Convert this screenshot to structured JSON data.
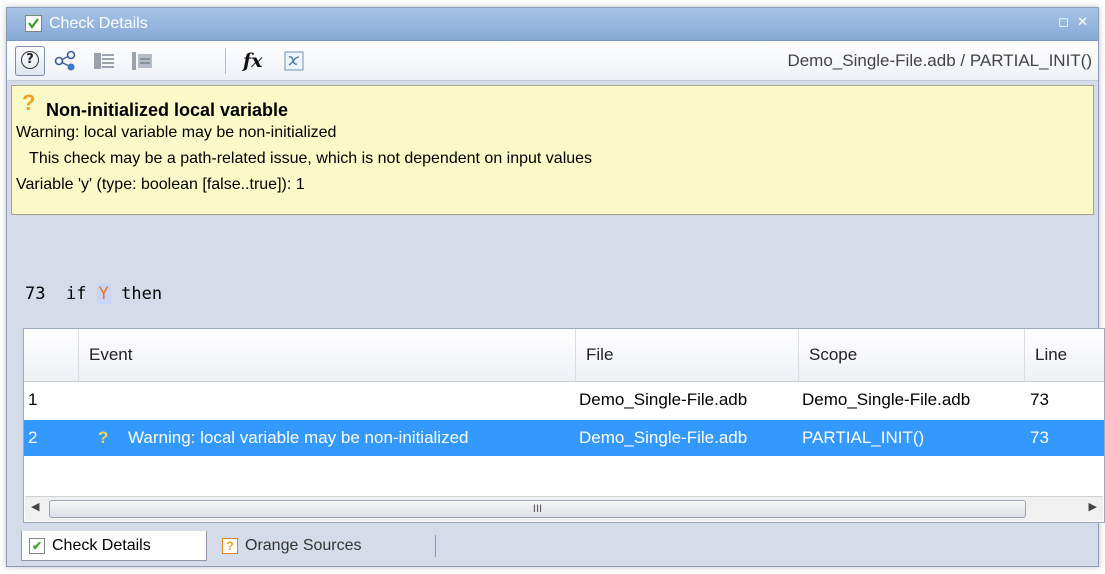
{
  "window": {
    "title": "Check Details",
    "controls": [
      "◻",
      "✕"
    ]
  },
  "toolbar": {
    "help_label": "?",
    "fx_label": "fx",
    "breadcrumb": "Demo_Single-File.adb / PARTIAL_INIT()"
  },
  "warning": {
    "icon": "question-icon",
    "title": "Non-initialized local variable",
    "lines": [
      "Warning: local variable may be non-initialized",
      "   This check may be a path-related issue, which is not dependent on input values",
      "Variable 'y' (type: boolean [false..true]): 1"
    ]
  },
  "code": {
    "line_number": "73",
    "before": "  if ",
    "variable": "Y",
    "after": " then"
  },
  "table": {
    "columns": [
      "Event",
      "File",
      "Scope",
      "Line"
    ],
    "rows": [
      {
        "index": "1",
        "event": "",
        "file": "Demo_Single-File.adb",
        "scope": "Demo_Single-File.adb",
        "line": "73"
      },
      {
        "index": "2",
        "event": "Warning: local variable may be non-initialized",
        "file": "Demo_Single-File.adb",
        "scope": "PARTIAL_INIT()",
        "line": "73"
      }
    ],
    "scroll_thumb": "III"
  },
  "tabs": [
    {
      "label": "Check Details",
      "icon": "check-icon"
    },
    {
      "label": "Orange Sources",
      "icon": "question-icon"
    }
  ],
  "colors": {
    "accent": "#3399ff",
    "warning_bg": "#fafac8",
    "orange": "#f0a020"
  }
}
